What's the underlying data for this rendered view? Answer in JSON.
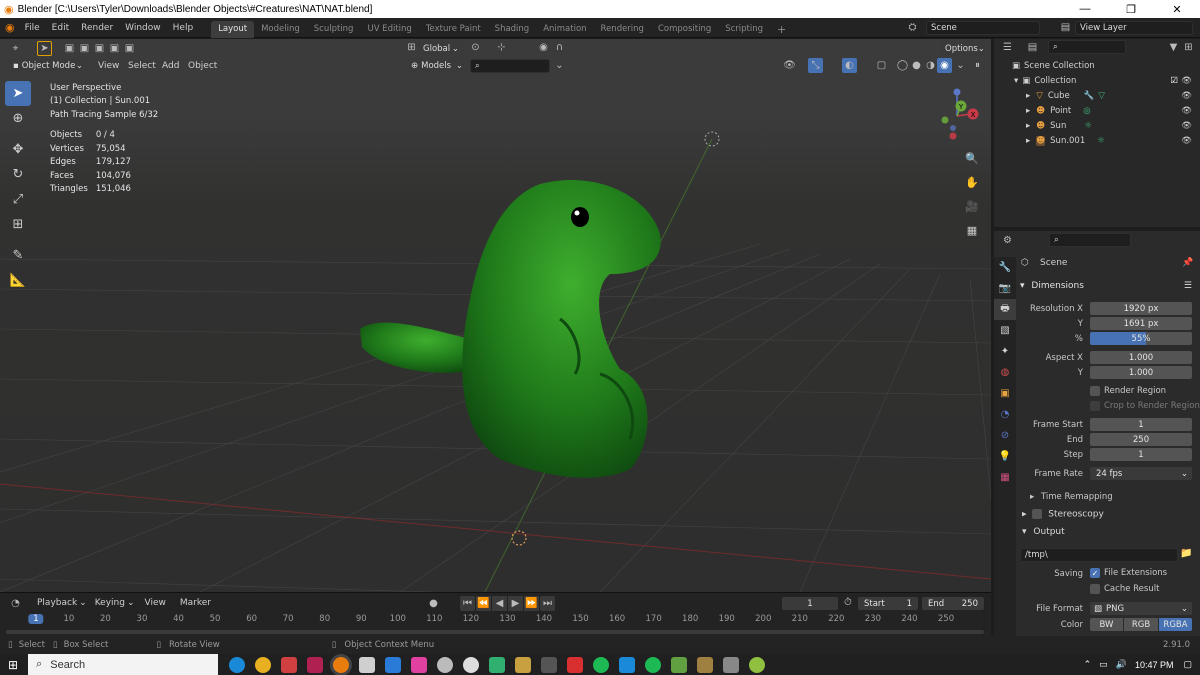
{
  "window": {
    "title": "Blender [C:\\Users\\Tyler\\Downloads\\Blender Objects\\#Creatures\\NAT\\NAT.blend]",
    "controls": [
      "—",
      "❐",
      "✕"
    ]
  },
  "menu": [
    "File",
    "Edit",
    "Render",
    "Window",
    "Help"
  ],
  "workspaces": [
    "Layout",
    "Modeling",
    "Sculpting",
    "UV Editing",
    "Texture Paint",
    "Shading",
    "Animation",
    "Rendering",
    "Compositing",
    "Scripting"
  ],
  "workspace_add": "+",
  "scene_field": "Scene",
  "view_layer_field": "View Layer",
  "viewport": {
    "header": {
      "orientation": "Global",
      "options": "Options",
      "mode": "Object Mode",
      "menus": [
        "View",
        "Select",
        "Add",
        "Object"
      ],
      "collection": "Models"
    },
    "overlay": [
      "User Perspective",
      "(1) Collection | Sun.001",
      "Path Tracing Sample 6/32"
    ],
    "stats": [
      {
        "label": "Objects",
        "value": "0 / 4"
      },
      {
        "label": "Vertices",
        "value": "75,054"
      },
      {
        "label": "Edges",
        "value": "179,127"
      },
      {
        "label": "Faces",
        "value": "104,076"
      },
      {
        "label": "Triangles",
        "value": "151,046"
      }
    ],
    "gizmo": {
      "z": "Z",
      "y": "Y",
      "x": "X"
    }
  },
  "outliner": {
    "root": "Scene Collection",
    "collection": "Collection",
    "items": [
      {
        "name": "Cube",
        "icon": "mesh-icon",
        "color": "#e8a040"
      },
      {
        "name": "Point",
        "icon": "light-icon",
        "color": "#e8a040"
      },
      {
        "name": "Sun",
        "icon": "light-icon",
        "color": "#e8a040"
      },
      {
        "name": "Sun.001",
        "icon": "light-icon",
        "color": "#e8a040"
      }
    ]
  },
  "properties": {
    "context": "Scene",
    "dimensions": "Dimensions",
    "labels": {
      "res_x": "Resolution X",
      "y1": "Y",
      "pct": "%",
      "aspect_x": "Aspect X",
      "y2": "Y",
      "frame_start": "Frame Start",
      "end": "End",
      "step": "Step",
      "frame_rate": "Frame Rate",
      "saving": "Saving",
      "file_format": "File Format",
      "color": "Color"
    },
    "values": {
      "res_x": "1920 px",
      "res_y": "1691 px",
      "pct": "55%",
      "aspect_x": "1.000",
      "aspect_y": "1.000",
      "frame_start": "1",
      "end": "250",
      "step": "1",
      "frame_rate": "24 fps",
      "output_path": "/tmp\\",
      "file_format": "PNG"
    },
    "pct_fraction": 0.55,
    "render_region": "Render Region",
    "crop_region": "Crop to Render Region",
    "time_remapping": "Time Remapping",
    "stereoscopy": "Stereoscopy",
    "output": "Output",
    "file_extensions": "File Extensions",
    "cache_result": "Cache Result",
    "color_modes": [
      "BW",
      "RGB",
      "RGBA"
    ]
  },
  "timeline": {
    "menus": [
      "Playback",
      "Keying",
      "View",
      "Marker"
    ],
    "current_frame": "1",
    "start_label": "Start",
    "start": "1",
    "end_label": "End",
    "end": "250",
    "ticks": [
      "1",
      "10",
      "20",
      "30",
      "40",
      "50",
      "60",
      "70",
      "80",
      "90",
      "100",
      "110",
      "120",
      "130",
      "140",
      "150",
      "160",
      "170",
      "180",
      "190",
      "200",
      "210",
      "220",
      "230",
      "240",
      "250"
    ]
  },
  "statusbar": {
    "select": "Select",
    "box_select": "Box Select",
    "rotate_view": "Rotate View",
    "context_menu": "Object Context Menu",
    "version": "2.91.0"
  },
  "taskbar": {
    "search": "Search",
    "time": "10:47 PM"
  }
}
